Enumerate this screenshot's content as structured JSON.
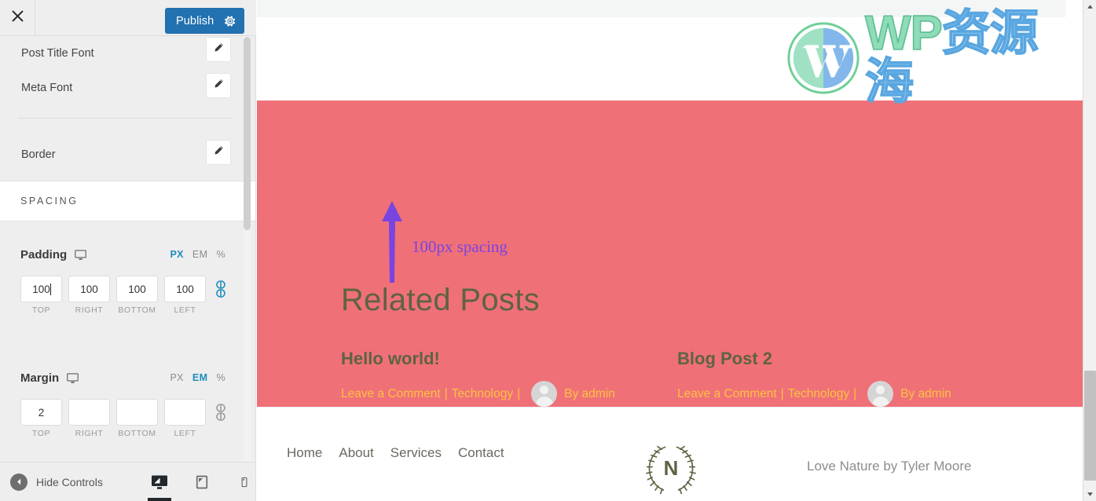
{
  "sidebar": {
    "header": {
      "close_icon": "close-icon",
      "publish_label": "Publish",
      "gear_icon": "gear-icon"
    },
    "font_rows": [
      {
        "label": "Post Title Font",
        "icon": "pencil-icon"
      },
      {
        "label": "Meta Font",
        "icon": "pencil-icon"
      },
      {
        "label": "Border",
        "icon": "pencil-icon"
      }
    ],
    "section_title": "SPACING",
    "padding": {
      "label": "Padding",
      "device_icon": "desktop-monitor-icon",
      "units": [
        "PX",
        "EM",
        "%"
      ],
      "active_unit": "PX",
      "fields": [
        {
          "value": "100",
          "sub": "TOP"
        },
        {
          "value": "100",
          "sub": "RIGHT"
        },
        {
          "value": "100",
          "sub": "BOTTOM"
        },
        {
          "value": "100",
          "sub": "LEFT"
        }
      ],
      "link_icon": "link-chain-icon",
      "linked": true
    },
    "margin": {
      "label": "Margin",
      "device_icon": "desktop-monitor-icon",
      "units": [
        "PX",
        "EM",
        "%"
      ],
      "active_unit": "EM",
      "fields": [
        {
          "value": "2",
          "sub": "TOP"
        },
        {
          "value": "",
          "sub": "RIGHT"
        },
        {
          "value": "",
          "sub": "BOTTOM"
        },
        {
          "value": "",
          "sub": "LEFT"
        }
      ],
      "link_icon": "link-chain-icon",
      "linked": false
    },
    "footer": {
      "hide_controls_label": "Hide Controls",
      "back_icon": "chevron-left-circle-icon",
      "devices": [
        {
          "name": "desktop",
          "icon": "desktop-preview-icon",
          "active": true
        },
        {
          "name": "tablet",
          "icon": "tablet-preview-icon",
          "active": false
        },
        {
          "name": "mobile",
          "icon": "mobile-preview-icon",
          "active": false
        }
      ]
    }
  },
  "preview": {
    "annotation": "100px spacing",
    "annotation_arrow": "up-arrow-annotation",
    "section_heading": "Related Posts",
    "posts": [
      {
        "title": "Hello world!",
        "comment_link": "Leave a Comment",
        "category": "Technology",
        "author": "By admin",
        "separator": "|",
        "avatar_icon": "user-avatar-icon"
      },
      {
        "title": "Blog Post 2",
        "comment_link": "Leave a Comment",
        "category": "Technology",
        "author": "By admin",
        "separator": "|",
        "avatar_icon": "user-avatar-icon"
      }
    ],
    "footer": {
      "nav": [
        "Home",
        "About",
        "Services",
        "Contact"
      ],
      "logo_letter": "N",
      "logo_icon": "laurel-wreath-logo",
      "credit": "Love Nature by Tyler Moore"
    }
  },
  "watermark": {
    "logo_icon": "wordpress-logo-icon",
    "text_en": "WP",
    "text_cn": "资源海"
  },
  "colors": {
    "publish_blue": "#2271b1",
    "hero_red": "#f07078",
    "heading_olive": "#5e6342",
    "meta_yellow": "#fcc23f",
    "annotation_purple": "#7a44e0",
    "unit_active_blue": "#1e8cbe",
    "sidebar_bg": "#eeeeee"
  }
}
